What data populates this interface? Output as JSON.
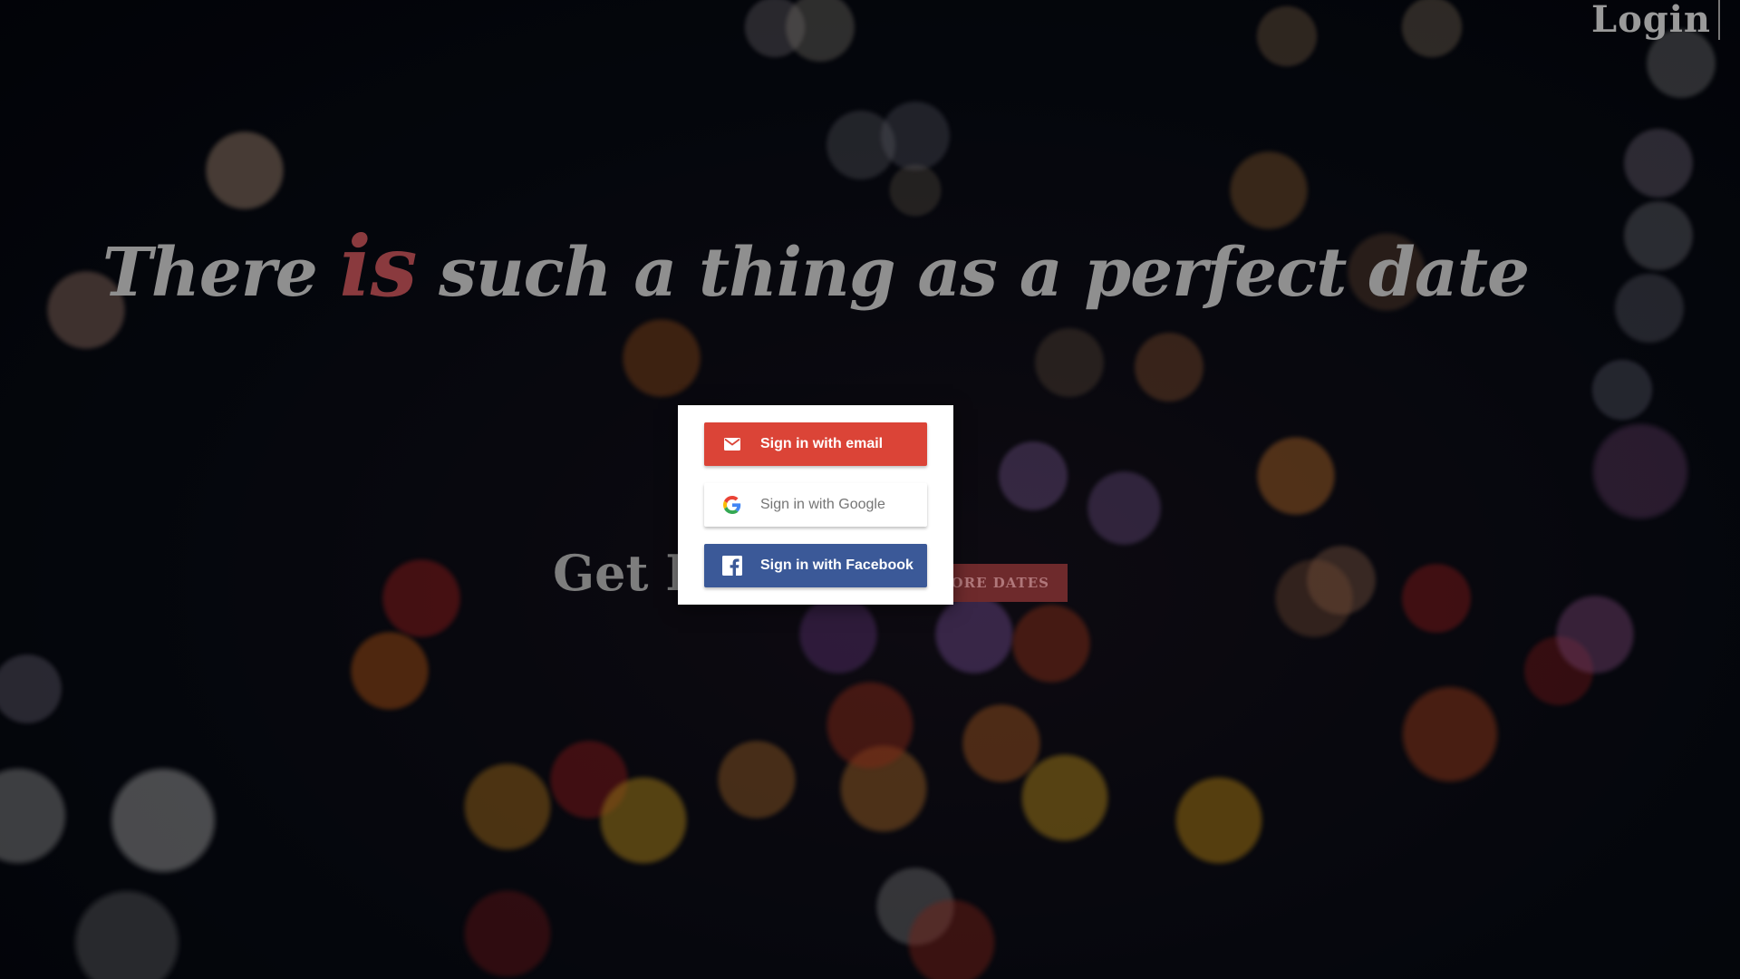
{
  "header": {
    "login_label": "Login"
  },
  "hero": {
    "headline_before": "There ",
    "headline_accent": "is",
    "headline_after": " such a thing as a perfect date",
    "cta_text": "Get In",
    "explore_label": "PLORE DATES"
  },
  "auth_modal": {
    "email_label": "Sign in with email",
    "google_label": "Sign in with Google",
    "facebook_label": "Sign in with Facebook"
  },
  "colors": {
    "email": "#db4437",
    "facebook": "#3b5998",
    "accent": "#8a3a3e"
  },
  "icons": {
    "email": "mail-icon",
    "google": "google-icon",
    "facebook": "facebook-icon"
  }
}
